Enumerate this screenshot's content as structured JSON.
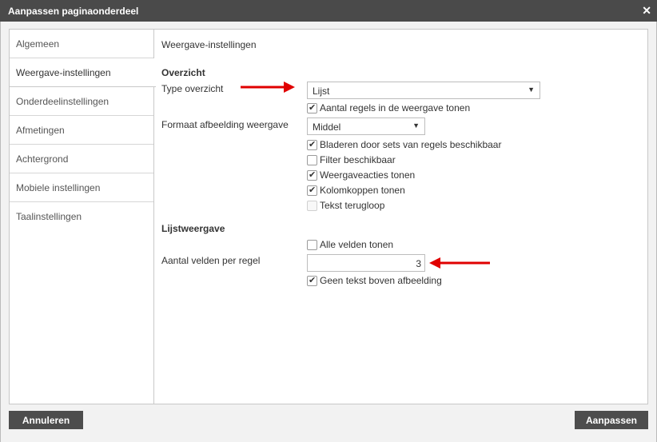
{
  "dialog": {
    "title": "Aanpassen paginaonderdeel"
  },
  "sidebar": {
    "items": [
      {
        "label": "Algemeen"
      },
      {
        "label": "Weergave-instellingen"
      },
      {
        "label": "Onderdeelinstellingen"
      },
      {
        "label": "Afmetingen"
      },
      {
        "label": "Achtergrond"
      },
      {
        "label": "Mobiele instellingen"
      },
      {
        "label": "Taalinstellingen"
      }
    ],
    "active": "Weergave-instellingen"
  },
  "content": {
    "section_title": "Weergave-instellingen",
    "overzicht": {
      "heading": "Overzicht",
      "type_label": "Type overzicht",
      "type_value": "Lijst",
      "show_rows_label": "Aantal regels in de weergave tonen",
      "image_format_label": "Formaat afbeelding weergave",
      "image_format_value": "Middel",
      "options": [
        {
          "label": "Bladeren door sets van regels beschikbaar",
          "checked": true
        },
        {
          "label": "Filter beschikbaar",
          "checked": false
        },
        {
          "label": "Weergaveacties tonen",
          "checked": true
        },
        {
          "label": "Kolomkoppen tonen",
          "checked": true
        },
        {
          "label": "Tekst terugloop",
          "checked": false,
          "disabled": true
        }
      ]
    },
    "lijstweergave": {
      "heading": "Lijstweergave",
      "all_fields_label": "Alle velden tonen",
      "fields_per_row_label": "Aantal velden per regel",
      "fields_per_row_value": "3",
      "no_text_above_image_label": "Geen tekst boven afbeelding"
    }
  },
  "footer": {
    "cancel_label": "Annuleren",
    "apply_label": "Aanpassen"
  },
  "colors": {
    "titlebar": "#4a4a4a",
    "button": "#4d4d4d",
    "annotation_arrow": "#e00000"
  }
}
